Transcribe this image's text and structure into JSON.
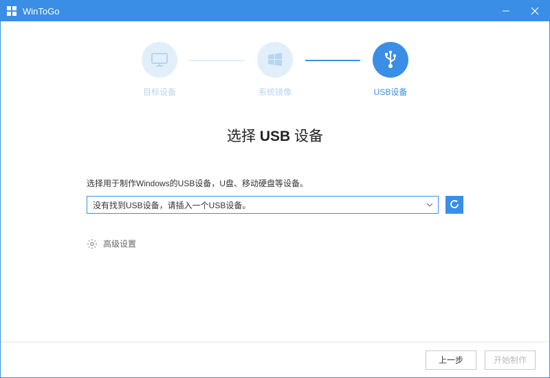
{
  "window": {
    "title": "WinToGo"
  },
  "stepper": {
    "steps": [
      {
        "label": "目标设备",
        "active": false
      },
      {
        "label": "系统镜像",
        "active": false
      },
      {
        "label": "USB设备",
        "active": true
      }
    ]
  },
  "main": {
    "title_pre": "选择 ",
    "title_bold": "USB",
    "title_post": " 设备",
    "instruction": "选择用于制作Windows的USB设备，U盘、移动硬盘等设备。",
    "usb_select_text": "没有找到USB设备，请插入一个USB设备。",
    "advanced_label": "高级设置"
  },
  "footer": {
    "prev_label": "上一步",
    "start_label": "开始制作"
  },
  "colors": {
    "accent": "#3a8ee6",
    "inactive": "#e1effa"
  }
}
